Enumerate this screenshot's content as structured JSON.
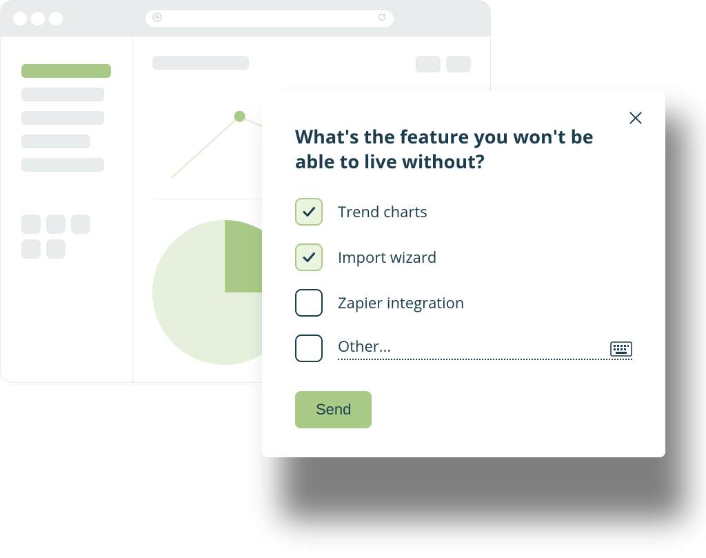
{
  "survey": {
    "question": "What's the feature you won't be able to live without?",
    "options": [
      {
        "label": "Trend charts",
        "checked": true
      },
      {
        "label": "Import wizard",
        "checked": true
      },
      {
        "label": "Zapier integration",
        "checked": false
      }
    ],
    "other_label": "Other...",
    "send_label": "Send"
  }
}
